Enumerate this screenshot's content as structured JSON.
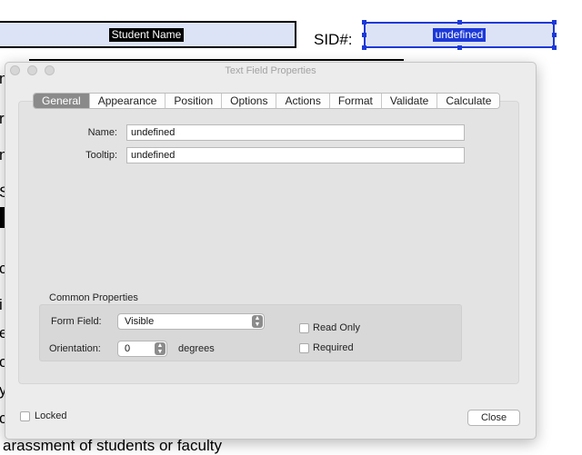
{
  "document": {
    "name_field_text": "Student Name",
    "sid_label": "SID#:",
    "sid_field_text": "undefined",
    "side_letters": [
      "n",
      "r",
      "n",
      "S",
      "c",
      "i",
      "e",
      "o",
      "y",
      "c"
    ],
    "bottom_text": "arassment of students or faculty"
  },
  "dialog": {
    "title": "Text Field Properties",
    "tabs": [
      {
        "label": "General",
        "active": true
      },
      {
        "label": "Appearance",
        "active": false
      },
      {
        "label": "Position",
        "active": false
      },
      {
        "label": "Options",
        "active": false
      },
      {
        "label": "Actions",
        "active": false
      },
      {
        "label": "Format",
        "active": false
      },
      {
        "label": "Validate",
        "active": false
      },
      {
        "label": "Calculate",
        "active": false
      }
    ],
    "name_label": "Name:",
    "name_value": "undefined",
    "tooltip_label": "Tooltip:",
    "tooltip_value": "undefined",
    "common_properties_title": "Common Properties",
    "form_field_label": "Form Field:",
    "form_field_value": "Visible",
    "orientation_label": "Orientation:",
    "orientation_value": "0",
    "orientation_unit": "degrees",
    "read_only_label": "Read Only",
    "read_only_checked": false,
    "required_label": "Required",
    "required_checked": false,
    "locked_label": "Locked",
    "locked_checked": false,
    "close_label": "Close"
  },
  "colors": {
    "selection_blue": "#1c39d8",
    "field_fill": "#dde3f7",
    "active_tab": "#8a8a8a"
  }
}
